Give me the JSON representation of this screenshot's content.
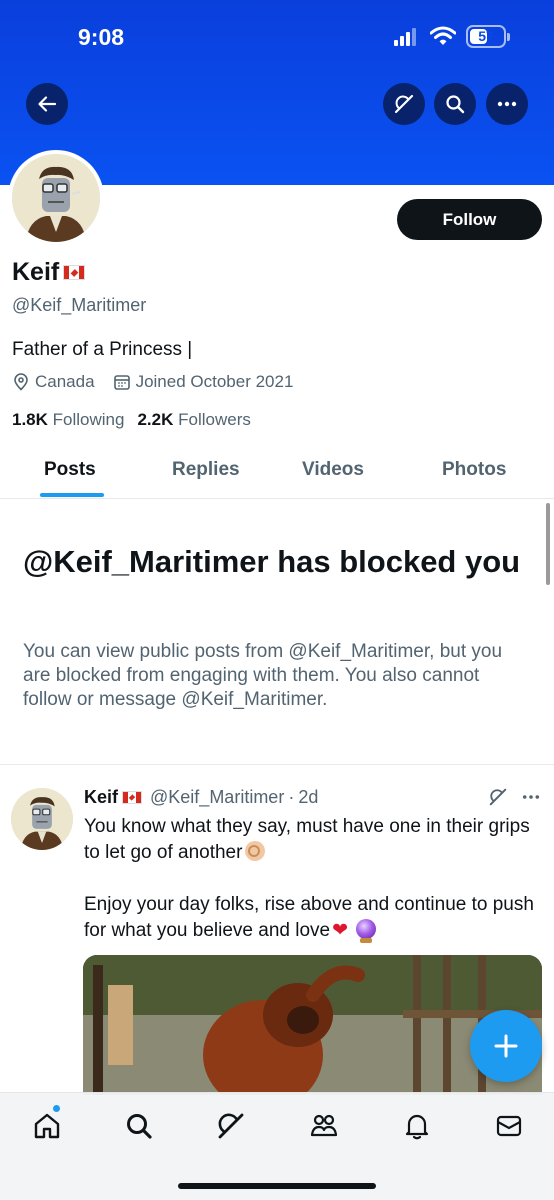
{
  "status_bar": {
    "time": "9:08",
    "battery": "57",
    "battery_level": 0.57
  },
  "header": {
    "back_icon": "arrow-left-icon",
    "grok_icon": "grok-icon",
    "search_icon": "search-icon",
    "more_icon": "more-icon",
    "colors": {
      "banner": "#0a48e8",
      "accent": "#1d9bf0"
    }
  },
  "profile": {
    "display_name": "Keif",
    "flag_icon": "canada-flag-icon",
    "handle": "@Keif_Maritimer",
    "bio": "Father of a Princess |",
    "location": "Canada",
    "joined": "Joined October 2021",
    "following_count": "1.8K",
    "following_label": "Following",
    "followers_count": "2.2K",
    "followers_label": "Followers",
    "follow_label": "Follow"
  },
  "tabs": [
    {
      "label": "Posts",
      "active": true
    },
    {
      "label": "Replies",
      "active": false
    },
    {
      "label": "Videos",
      "active": false
    },
    {
      "label": "Photos",
      "active": false
    }
  ],
  "blocked": {
    "title": "@Keif_Maritimer has blocked you",
    "body": "You can view public posts from @Keif_Maritimer, but you are blocked from engaging with them. You also cannot follow or message @Keif_Maritimer."
  },
  "post": {
    "author_name": "Keif",
    "author_handle": "@Keif_Maritimer",
    "separator": "·",
    "time": "2d",
    "line1": "You know what they say, must have one in their grips to let go of another",
    "line2": "Enjoy your day folks, rise above and continue to push for what you believe and love"
  },
  "fab": {
    "icon": "plus-icon"
  },
  "bottom_nav": [
    {
      "icon": "home-icon",
      "has_notification_dot": true
    },
    {
      "icon": "search-icon"
    },
    {
      "icon": "grok-icon"
    },
    {
      "icon": "communities-icon"
    },
    {
      "icon": "bell-icon"
    },
    {
      "icon": "mail-icon"
    }
  ]
}
